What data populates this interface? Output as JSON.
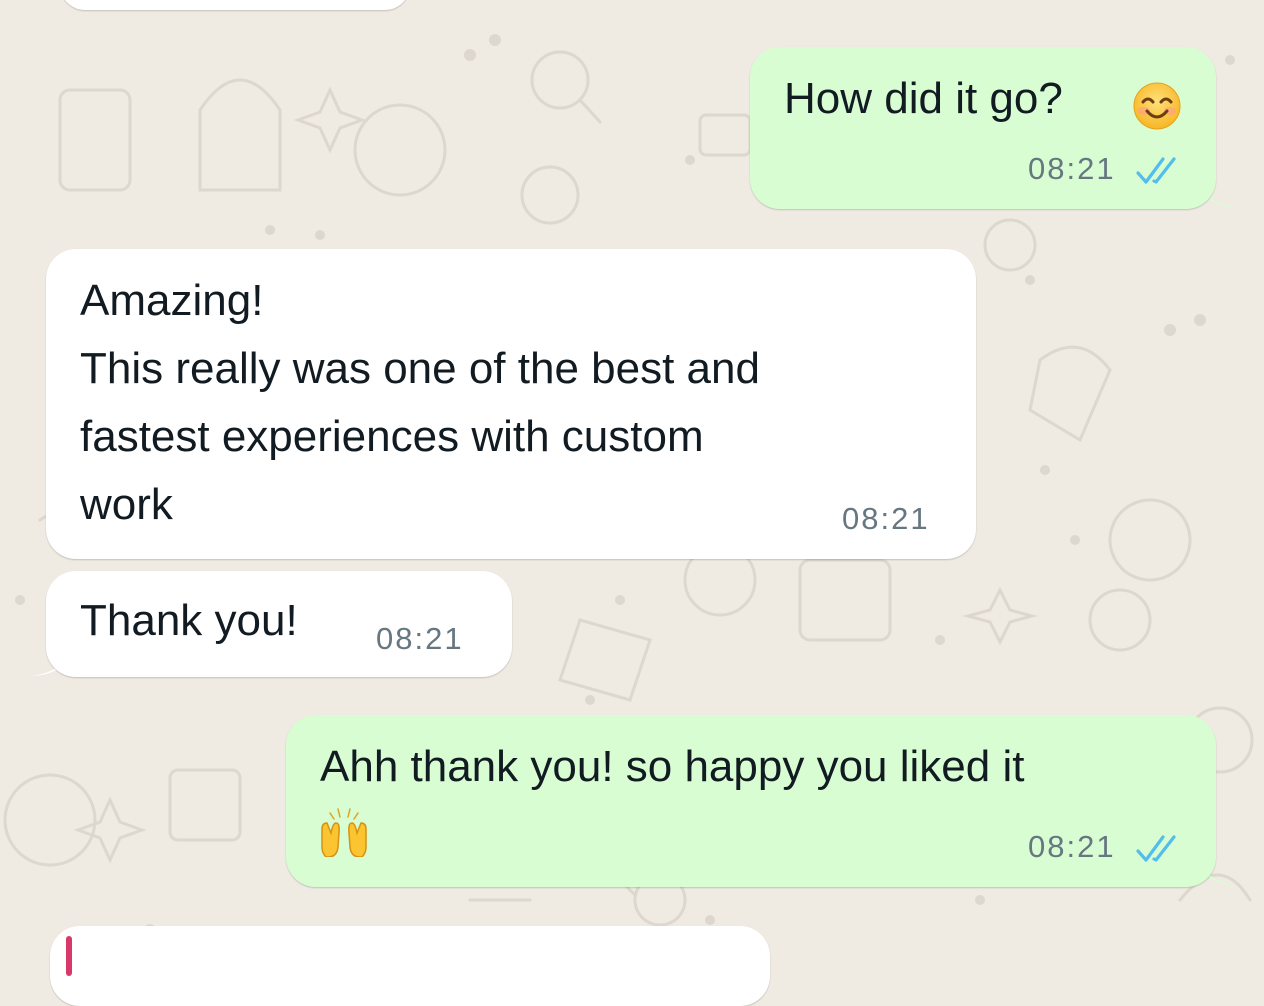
{
  "chat": {
    "messages": [
      {
        "direction": "outgoing",
        "text": "How did it go?",
        "emoji": "smiling-face-icon",
        "time": "08:21",
        "status": "read"
      },
      {
        "direction": "incoming",
        "text": "Amazing!\nThis really was one of the best and\nfastest experiences with custom\nwork",
        "time": "08:21"
      },
      {
        "direction": "incoming",
        "text": "Thank you!",
        "time": "08:21"
      },
      {
        "direction": "outgoing",
        "text": "Ahh thank you! so happy you liked it",
        "emoji": "raising-hands-icon",
        "time": "08:21",
        "status": "read"
      }
    ]
  },
  "colors": {
    "background": "#efeae2",
    "outgoing_bubble": "#d9fdd3",
    "incoming_bubble": "#ffffff",
    "read_tick": "#53bdeb",
    "timestamp": "#667781"
  }
}
